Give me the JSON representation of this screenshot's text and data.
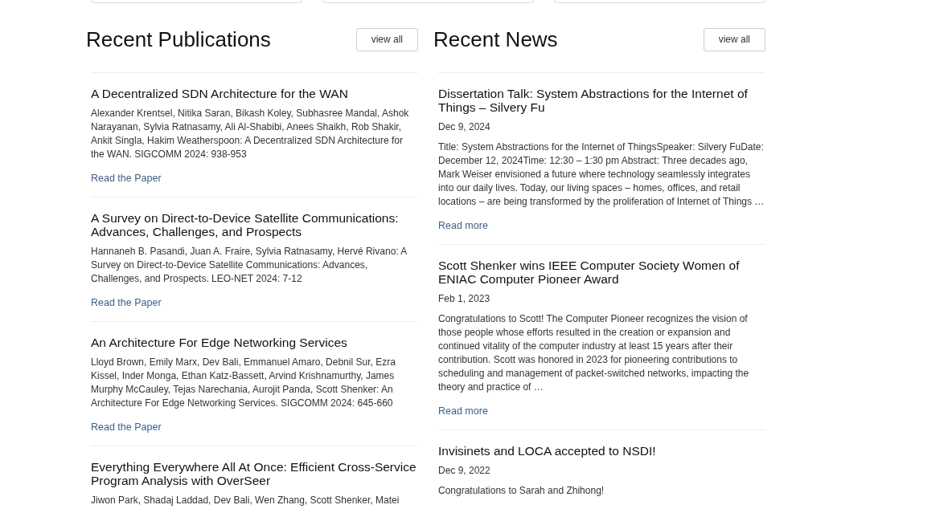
{
  "publications": {
    "title": "Recent Publications",
    "view_all": "view all",
    "items": [
      {
        "title": "A Decentralized SDN Architecture for the WAN",
        "citation": "Alexander Krentsel, Nitika Saran, Bikash Koley, Subhasree Mandal, Ashok Narayanan, Sylvia Ratnasamy, Ali Al-Shabibi, Anees Shaikh, Rob Shakir, Ankit Singla, Hakim Weatherspoon: A Decentralized SDN Architecture for the WAN. SIGCOMM 2024: 938-953",
        "link": "Read the Paper"
      },
      {
        "title": "A Survey on Direct-to-Device Satellite Communications: Advances, Challenges, and Prospects",
        "citation": "Hannaneh B. Pasandi, Juan A. Fraire, Sylvia Ratnasamy, Hervé Rivano: A Survey on Direct-to-Device Satellite Communications: Advances, Challenges, and Prospects. LEO-NET 2024: 7-12",
        "link": "Read the Paper"
      },
      {
        "title": "An Architecture For Edge Networking Services",
        "citation": "Lloyd Brown, Emily Marx, Dev Bali, Emmanuel Amaro, Debnil Sur, Ezra Kissel, Inder Monga, Ethan Katz-Bassett, Arvind Krishnamurthy, James Murphy McCauley, Tejas Narechania, Aurojit Panda, Scott Shenker: An Architecture For Edge Networking Services. SIGCOMM 2024: 645-660",
        "link": "Read the Paper"
      },
      {
        "title": "Everything Everywhere All At Once: Efficient Cross-Service Program Analysis with OverSeer",
        "citation": "Jiwon Park, Shadaj Laddad, Dev Bali, Wen Zhang, Scott Shenker, Matei"
      }
    ]
  },
  "news": {
    "title": "Recent News",
    "view_all": "view all",
    "items": [
      {
        "title": "Dissertation Talk: System Abstractions for the Internet of Things – Silvery Fu",
        "date": "Dec 9, 2024",
        "summary": "Title: System Abstractions for the Internet of ThingsSpeaker: Silvery FuDate: December 12, 2024Time: 12:30 – 1:30 pm Abstract: Three decades ago, Mark Weiser envisioned a future where technology seamlessly integrates into our daily lives. Today, our living spaces – homes, offices, and retail locations – are being transformed by the proliferation of Internet of Things …",
        "link": "Read more"
      },
      {
        "title": "Scott Shenker wins IEEE Computer Society Women of ENIAC Computer Pioneer Award",
        "date": "Feb 1, 2023",
        "summary": "Congratulations to Scott! The Computer Pioneer recognizes the vision of those people whose efforts resulted in the creation or expansion and continued vitality of the computer industry at least 15 years after their contribution. Scott was honored in 2023 for pioneering contributions to scheduling and management of packet-switched networks, impacting the theory and practice of …",
        "link": "Read more"
      },
      {
        "title": "Invisinets and LOCA accepted to NSDI!",
        "date": "Dec 9, 2022",
        "summary": "Congratulations to Sarah and Zhihong!"
      }
    ]
  }
}
